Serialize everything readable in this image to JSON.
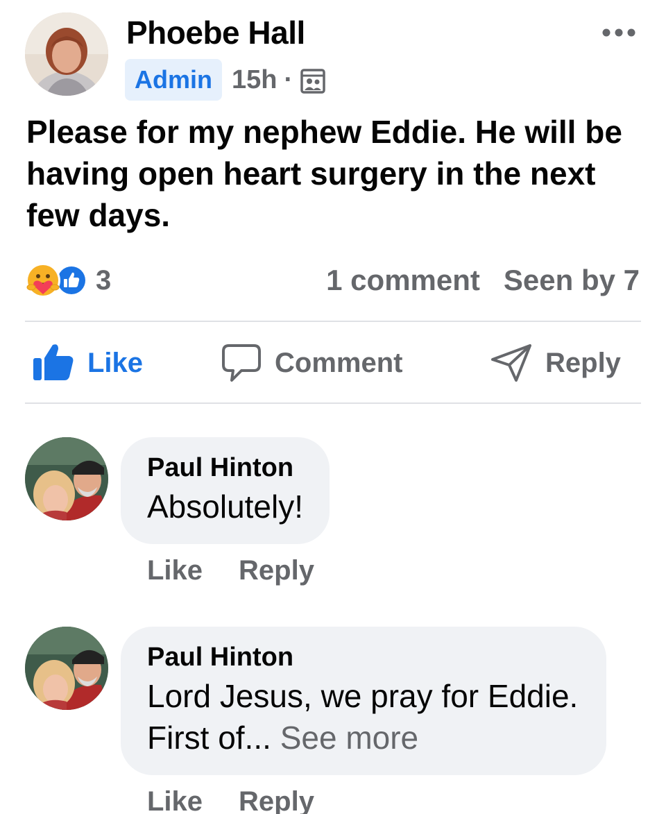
{
  "post": {
    "author": "Phoebe Hall",
    "badge": "Admin",
    "time": "15h",
    "separator": "·",
    "audience_icon": "group-audience-icon",
    "text": "Please for my nephew Eddie. He will be having open heart surgery in the next few days.",
    "reaction_icons": [
      "care-reaction-icon",
      "like-reaction-icon"
    ],
    "reaction_count": "3",
    "comments_count": "1 comment",
    "seen_by": "Seen by 7"
  },
  "actions": {
    "like": "Like",
    "comment": "Comment",
    "reply": "Reply"
  },
  "comments": [
    {
      "author": "Paul Hinton",
      "text": "Absolutely!",
      "like": "Like",
      "reply": "Reply"
    },
    {
      "author": "Paul Hinton",
      "text": "Lord Jesus, we pray for Eddie. First of...",
      "see_more": "See more",
      "like": "Like",
      "reply": "Reply"
    }
  ],
  "colors": {
    "accent": "#1b74e4",
    "muted": "#65676b",
    "bubble": "#f0f2f5",
    "badge_bg": "#e6f0fc"
  }
}
